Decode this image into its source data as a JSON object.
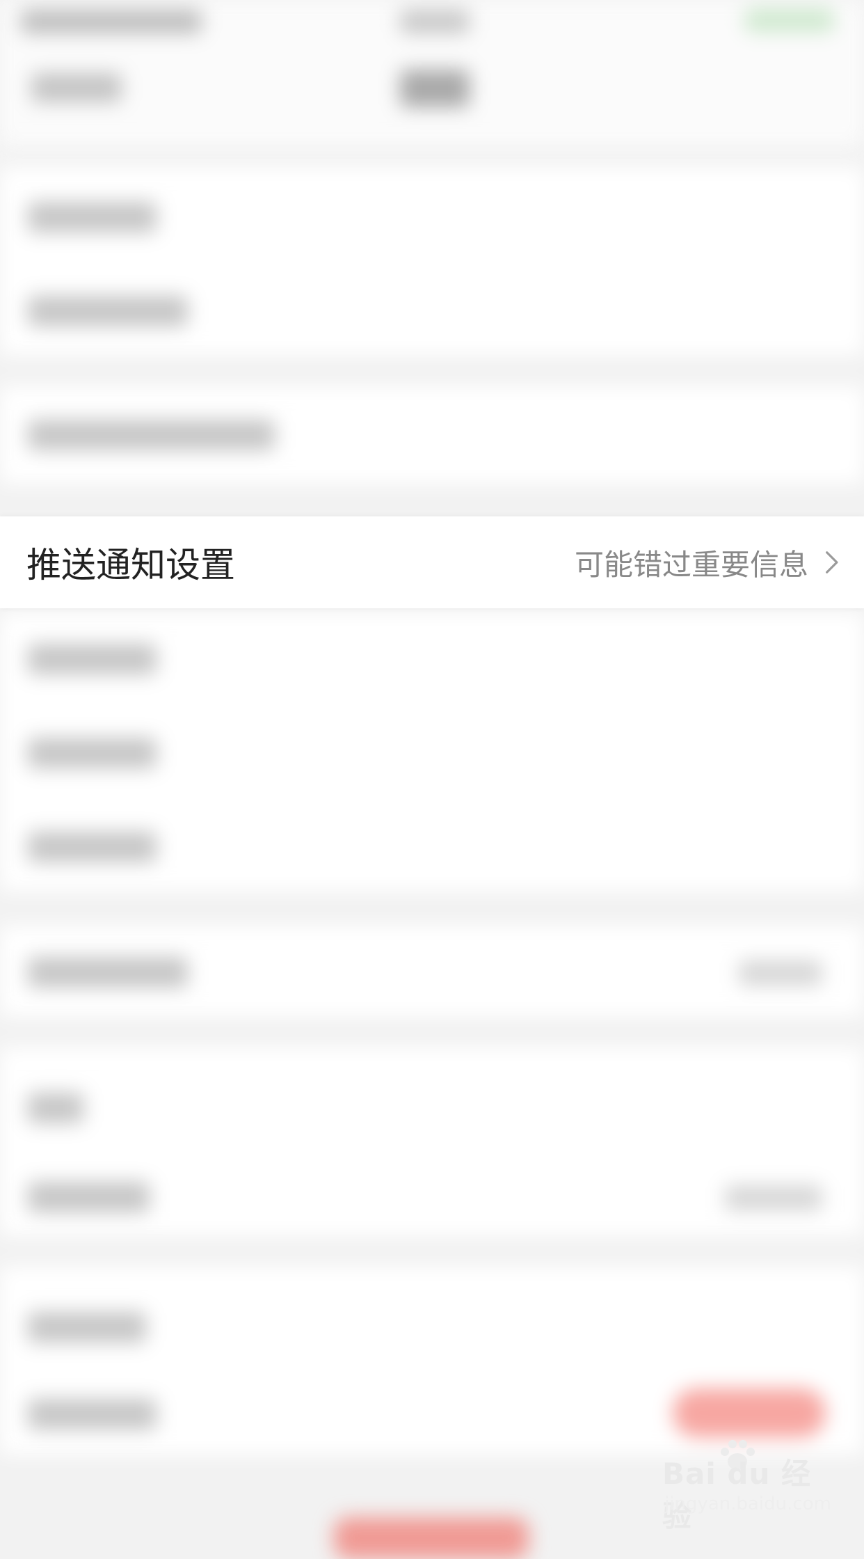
{
  "setting": {
    "label": "推送通知设置",
    "hint": "可能错过重要信息"
  },
  "watermark": {
    "logo": "Bai du 经验",
    "url": "jingyan.baidu.com"
  },
  "colors": {
    "background": "#f2f2f2",
    "row": "#ffffff",
    "label": "#222222",
    "hint": "#888888",
    "accent_red": "#f7a7a2"
  },
  "icons": [
    "chevron-right-icon",
    "baidu-paw-icon"
  ]
}
